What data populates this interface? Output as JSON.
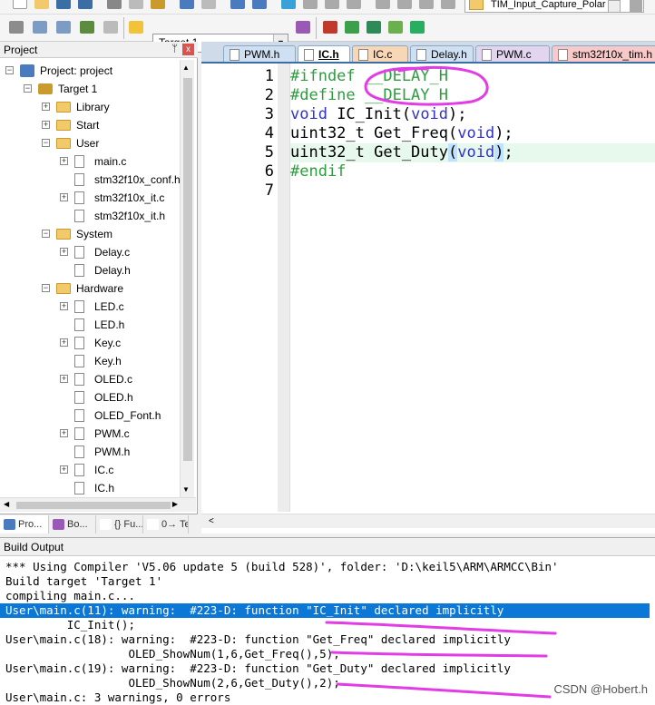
{
  "window": {
    "title": "TIM_Input_Capture_Polar"
  },
  "toolbar": {
    "target": "Target 1"
  },
  "project_panel": {
    "header": "Project",
    "pin": "ᛘ",
    "close": "x",
    "root": "Project: project",
    "target": "Target 1",
    "tree": [
      {
        "label": "Library",
        "type": "folder",
        "depth": 2,
        "expander": "+"
      },
      {
        "label": "Start",
        "type": "folder",
        "depth": 2,
        "expander": "+"
      },
      {
        "label": "User",
        "type": "folder",
        "depth": 2,
        "expander": "−"
      },
      {
        "label": "main.c",
        "type": "file",
        "depth": 3,
        "expander": "+"
      },
      {
        "label": "stm32f10x_conf.h",
        "type": "file",
        "depth": 3,
        "expander": ""
      },
      {
        "label": "stm32f10x_it.c",
        "type": "file",
        "depth": 3,
        "expander": "+"
      },
      {
        "label": "stm32f10x_it.h",
        "type": "file",
        "depth": 3,
        "expander": ""
      },
      {
        "label": "System",
        "type": "folder",
        "depth": 2,
        "expander": "−"
      },
      {
        "label": "Delay.c",
        "type": "file",
        "depth": 3,
        "expander": "+"
      },
      {
        "label": "Delay.h",
        "type": "file",
        "depth": 3,
        "expander": ""
      },
      {
        "label": "Hardware",
        "type": "folder",
        "depth": 2,
        "expander": "−"
      },
      {
        "label": "LED.c",
        "type": "file",
        "depth": 3,
        "expander": "+"
      },
      {
        "label": "LED.h",
        "type": "file",
        "depth": 3,
        "expander": ""
      },
      {
        "label": "Key.c",
        "type": "file",
        "depth": 3,
        "expander": "+"
      },
      {
        "label": "Key.h",
        "type": "file",
        "depth": 3,
        "expander": ""
      },
      {
        "label": "OLED.c",
        "type": "file",
        "depth": 3,
        "expander": "+"
      },
      {
        "label": "OLED.h",
        "type": "file",
        "depth": 3,
        "expander": ""
      },
      {
        "label": "OLED_Font.h",
        "type": "file",
        "depth": 3,
        "expander": ""
      },
      {
        "label": "PWM.c",
        "type": "file",
        "depth": 3,
        "expander": "+"
      },
      {
        "label": "PWM.h",
        "type": "file",
        "depth": 3,
        "expander": ""
      },
      {
        "label": "IC.c",
        "type": "file",
        "depth": 3,
        "expander": "+"
      },
      {
        "label": "IC.h",
        "type": "file",
        "depth": 3,
        "expander": ""
      }
    ],
    "bottom_tabs": [
      {
        "label": "Pro...",
        "icon": "project-icon",
        "color": "#4a7bbf"
      },
      {
        "label": "Bo...",
        "icon": "books-icon",
        "color": "#9b59b6"
      },
      {
        "label": "{} Fu...",
        "icon": "functions-icon",
        "color": "#ffffff"
      },
      {
        "label": "0→ Te...",
        "icon": "templates-icon",
        "color": "#ffffff"
      }
    ]
  },
  "editor": {
    "tabs": [
      {
        "label": "PWM.h",
        "color": "#cfe0f3",
        "active": false
      },
      {
        "label": "IC.h",
        "color": "#ffffff",
        "active": true
      },
      {
        "label": "IC.c",
        "color": "#f7d7b5",
        "active": false
      },
      {
        "label": "Delay.h",
        "color": "#cfe0f3",
        "active": false
      },
      {
        "label": "PWM.c",
        "color": "#e1d5f0",
        "active": false
      },
      {
        "label": "stm32f10x_tim.h",
        "color": "#f7c9c9",
        "active": false
      }
    ],
    "lines": [
      {
        "num": "1",
        "segments": [
          {
            "t": "#ifndef __DELAY_H",
            "c": "pp"
          }
        ]
      },
      {
        "num": "2",
        "segments": [
          {
            "t": "#define __DELAY_H",
            "c": "pp"
          }
        ]
      },
      {
        "num": "3",
        "segments": [
          {
            "t": "void",
            "c": "kw"
          },
          {
            "t": " IC_Init(",
            "c": ""
          },
          {
            "t": "void",
            "c": "kw"
          },
          {
            "t": ");",
            "c": ""
          }
        ]
      },
      {
        "num": "4",
        "segments": [
          {
            "t": "uint32_t Get_Freq(",
            "c": ""
          },
          {
            "t": "void",
            "c": "kw"
          },
          {
            "t": ");",
            "c": ""
          }
        ]
      },
      {
        "num": "5",
        "segments": [
          {
            "t": "uint32_t Get_Duty",
            "c": ""
          },
          {
            "t": "(",
            "c": "paren-hl"
          },
          {
            "t": "void",
            "c": "kw"
          },
          {
            "t": ")",
            "c": "paren-hl"
          },
          {
            "t": ";",
            "c": ""
          }
        ],
        "highlight": true
      },
      {
        "num": "6",
        "segments": [
          {
            "t": "#endif",
            "c": "pp"
          }
        ]
      },
      {
        "num": "7",
        "segments": []
      }
    ]
  },
  "build_output": {
    "header": "Build Output",
    "lines": [
      {
        "text": "*** Using Compiler 'V5.06 update 5 (build 528)', folder: 'D:\\keil5\\ARM\\ARMCC\\Bin'",
        "selected": false
      },
      {
        "text": "Build target 'Target 1'",
        "selected": false
      },
      {
        "text": "compiling main.c...",
        "selected": false
      },
      {
        "text": "User\\main.c(11): warning:  #223-D: function \"IC_Init\" declared implicitly",
        "selected": true
      },
      {
        "text": "         IC_Init();",
        "selected": false
      },
      {
        "text": "User\\main.c(18): warning:  #223-D: function \"Get_Freq\" declared implicitly",
        "selected": false
      },
      {
        "text": "                  OLED_ShowNum(1,6,Get_Freq(),5);",
        "selected": false
      },
      {
        "text": "User\\main.c(19): warning:  #223-D: function \"Get_Duty\" declared implicitly",
        "selected": false
      },
      {
        "text": "                  OLED_ShowNum(2,6,Get_Duty(),2);",
        "selected": false
      },
      {
        "text": "User\\main.c: 3 warnings, 0 errors",
        "selected": false
      }
    ],
    "watermark": "CSDN @Hobert.h"
  }
}
